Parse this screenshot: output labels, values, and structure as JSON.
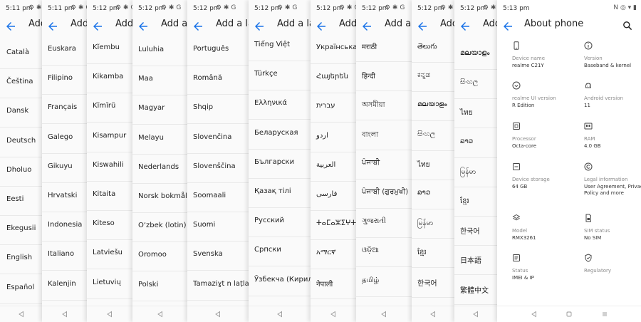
{
  "status_icons": "⚙ ✱ G",
  "about_status_icons": "N ◎ ▾ ▮",
  "panels": [
    {
      "time": "5:11 pm",
      "title": "Add a language",
      "items": [
        "Català",
        "Čeština",
        "Dansk",
        "Deutsch",
        "Dholuo",
        "Eesti",
        "Ekegusii",
        "English",
        "Español"
      ]
    },
    {
      "time": "5:11 pm",
      "title": "Add a language",
      "items": [
        "Euskara",
        "Filipino",
        "Français",
        "Galego",
        "Gikuyu",
        "Hrvatski",
        "Indonesia",
        "Italiano",
        "Kalenjin"
      ]
    },
    {
      "time": "5:12 pm",
      "title": "Add a language",
      "items": [
        "Kĩembu",
        "Kikamba",
        "Kĩmĩrũ",
        "Kisampur",
        "Kiswahili",
        "Kitaita",
        "Kiteso",
        "Latviešu",
        "Lietuvių"
      ]
    },
    {
      "time": "5:12 pm",
      "title": "Add a language",
      "items": [
        "Luluhia",
        "Maa",
        "Magyar",
        "Melayu",
        "Nederlands",
        "Norsk bokmål",
        "O‘zbek (lotin)",
        "Oromoo",
        "Polski"
      ]
    },
    {
      "time": "5:12 pm",
      "title": "Add a language",
      "items": [
        "Português",
        "Română",
        "Shqip",
        "Slovenčina",
        "Slovenščina",
        "Soomaali",
        "Suomi",
        "Svenska",
        "Tamaziɣt n laṭlaṣ"
      ]
    },
    {
      "time": "5:12 pm",
      "title": "Add a language",
      "items": [
        "Tiếng Việt",
        "Türkçe",
        "Ελληνικά",
        "Беларуская",
        "Български",
        "Қазақ тілі",
        "Русский",
        "Српски",
        "Ўзбекча (Кирил)"
      ]
    },
    {
      "time": "5:12 pm",
      "title": "Add a language",
      "items": [
        "Українська",
        "Հայերեն",
        "עברית",
        "اردو",
        "العربية",
        "فارسی",
        "ⵜⴰⵎⴰⵣⵉⵖⵜ",
        "አማርኛ",
        "नेपाली"
      ]
    },
    {
      "time": "5:12 pm",
      "title": "Add a language",
      "items": [
        "मराठी",
        "हिन्दी",
        "অসমীয়া",
        "বাংলা",
        "ਪੰਜਾਬੀ",
        "ਪੰਜਾਬੀ (ਗੁਰਮੁਖੀ)",
        "ગુજરાતી",
        "ଓଡ଼ିଆ",
        "தமிழ்"
      ]
    },
    {
      "time": "5:12 pm",
      "title": "Add a language",
      "items": [
        "తెలుగు",
        "ಕನ್ನಡ",
        "മലയാളം",
        "සිංහල",
        "ไทย",
        "ລາວ",
        "မြန်မာ",
        "ខ្មែរ",
        "한국어"
      ]
    },
    {
      "time": "5:12 pm",
      "title": "Add a language",
      "items": [
        "മലയാളം",
        "සිංහල",
        "ไทย",
        "ລາວ",
        "မြန်မာ",
        "ខ្មែរ",
        "한국어",
        "日本語",
        "繁體中文"
      ]
    }
  ],
  "about": {
    "time": "5:13 pm",
    "title": "About phone",
    "items": [
      {
        "icon": "phone-icon",
        "label": "Device name",
        "value": "realme C21Y"
      },
      {
        "icon": "info-icon",
        "label": "Version",
        "value": "Baseband & kernel"
      },
      {
        "icon": "ui-version-icon",
        "label": "realme UI version",
        "value": "R Edition"
      },
      {
        "icon": "android-icon",
        "label": "Android version",
        "value": "11"
      },
      {
        "icon": "processor-icon",
        "label": "Processor",
        "value": "Octa-core"
      },
      {
        "icon": "ram-icon",
        "label": "RAM",
        "value": "4.0 GB"
      },
      {
        "icon": "storage-icon",
        "label": "Device storage",
        "value": "64 GB"
      },
      {
        "icon": "legal-icon",
        "label": "Legal information",
        "value": "User Agreement, Privacy Policy and more"
      },
      {
        "icon": "layers-icon",
        "label": "Model",
        "value": "RMX3261"
      },
      {
        "icon": "sim-icon",
        "label": "SIM status",
        "value": "No SIM"
      },
      {
        "icon": "status-icon",
        "label": "Status",
        "value": "IMEI & IP"
      },
      {
        "icon": "shield-icon",
        "label": "Regulatory",
        "value": ""
      }
    ]
  },
  "colors": {
    "accent": "#1a73e8",
    "divider": "#e9e9e9"
  }
}
